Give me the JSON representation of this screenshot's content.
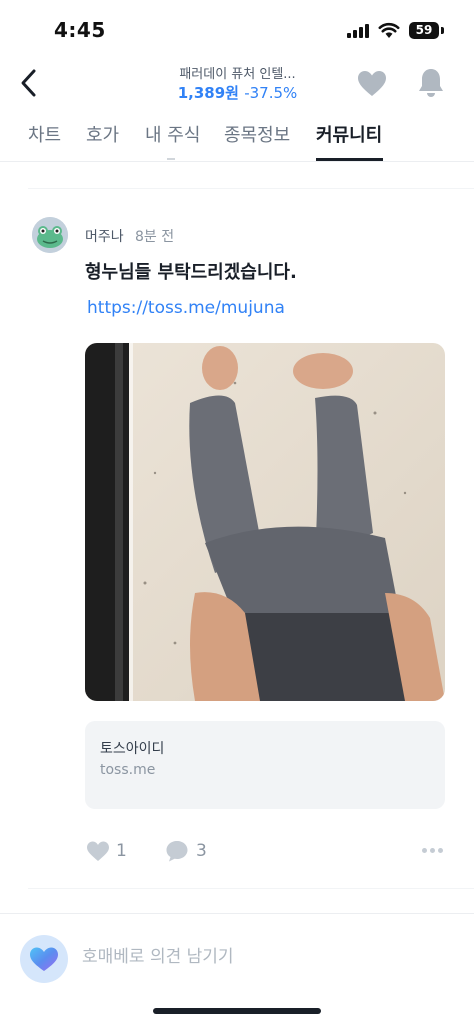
{
  "status_bar": {
    "time": "4:45",
    "battery": "59"
  },
  "header": {
    "stock_name": "패러데이 퓨처 인텔...",
    "price": "1,389원",
    "change": "-37.5%",
    "accent_color": "#3182f6"
  },
  "tabs": [
    {
      "label": "차트"
    },
    {
      "label": "호가"
    },
    {
      "label": "내 주식"
    },
    {
      "label": "종목정보"
    },
    {
      "label": "커뮤니티"
    }
  ],
  "post": {
    "author": "머주나",
    "time": "8분 전",
    "text": "형누님들 부탁드리겠습니다.",
    "link": "https://toss.me/mujuna",
    "image_icon": "photo-of-person-legs-up-wall",
    "link_card": {
      "title": "토스아이디",
      "domain": "toss.me"
    },
    "likes": "1",
    "comments": "3"
  },
  "comment_bar": {
    "placeholder": "호매베로 의견 남기기"
  }
}
